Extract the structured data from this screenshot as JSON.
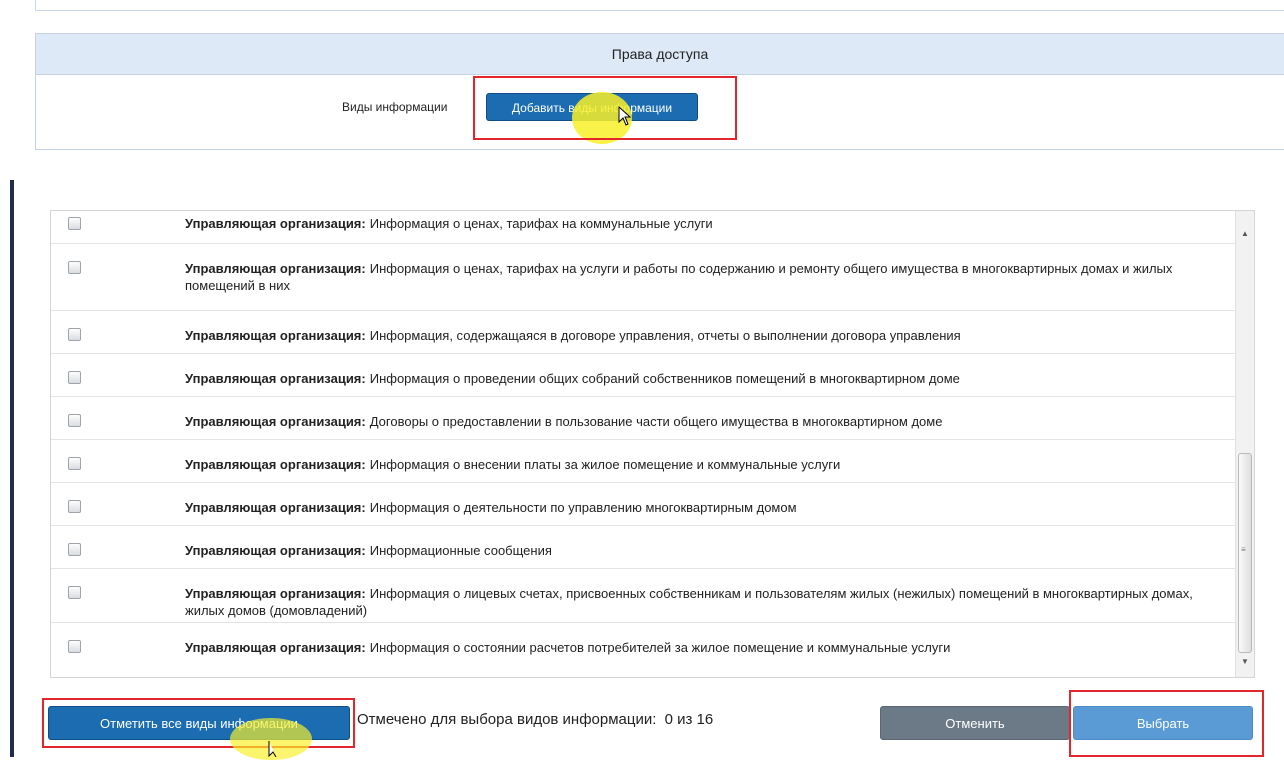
{
  "access_panel": {
    "title": "Права доступа",
    "info_label": "Виды информации",
    "add_button_label": "Добавить виды информации"
  },
  "info_list": {
    "items": [
      {
        "org": "Управляющая организация:",
        "text": "Информация о ценах, тарифах на коммунальные услуги",
        "checked": false
      },
      {
        "org": "Управляющая организация:",
        "text": "Информация о ценах, тарифах на услуги и работы по содержанию и ремонту общего имущества в многоквартирных домах и жилых помещений в них",
        "checked": false
      },
      {
        "org": "Управляющая организация:",
        "text": "Информация, содержащаяся в договоре управления, отчеты о выполнении договора управления",
        "checked": false
      },
      {
        "org": "Управляющая организация:",
        "text": "Информация о проведении общих собраний собственников помещений в многоквартирном доме",
        "checked": false
      },
      {
        "org": "Управляющая организация:",
        "text": "Договоры о предоставлении в пользование части общего имущества в многоквартирном доме",
        "checked": false
      },
      {
        "org": "Управляющая организация:",
        "text": "Информация о внесении платы за жилое помещение и коммунальные услуги",
        "checked": false
      },
      {
        "org": "Управляющая организация:",
        "text": "Информация о деятельности по управлению многоквартирным домом",
        "checked": false
      },
      {
        "org": "Управляющая организация:",
        "text": "Информационные сообщения",
        "checked": false
      },
      {
        "org": "Управляющая организация:",
        "text": "Информация о лицевых счетах, присвоенных собственникам и пользователям жилых (нежилых) помещений в многоквартирных домах, жилых домов (домовладений)",
        "checked": false
      },
      {
        "org": "Управляющая организация:",
        "text": "Информация о состоянии расчетов потребителей за жилое помещение и коммунальные услуги",
        "checked": false
      }
    ]
  },
  "footer": {
    "mark_all_label": "Отметить все виды информации",
    "counter_text": "Отмечено для выбора видов информации:",
    "counter_value": "0 из 16",
    "cancel_label": "Отменить",
    "select_label": "Выбрать"
  },
  "icons": {
    "scroll_up": "arrow-up-icon",
    "scroll_down": "arrow-down-icon",
    "cursor": "mouse-pointer-icon"
  },
  "colors": {
    "primary_button": "#1b6cb0",
    "cancel_button": "#6c7986",
    "select_button": "#5b9bd5",
    "panel_header": "#dde9f6",
    "highlight_box": "#e2262b",
    "cursor_halo": "#f8f028"
  }
}
